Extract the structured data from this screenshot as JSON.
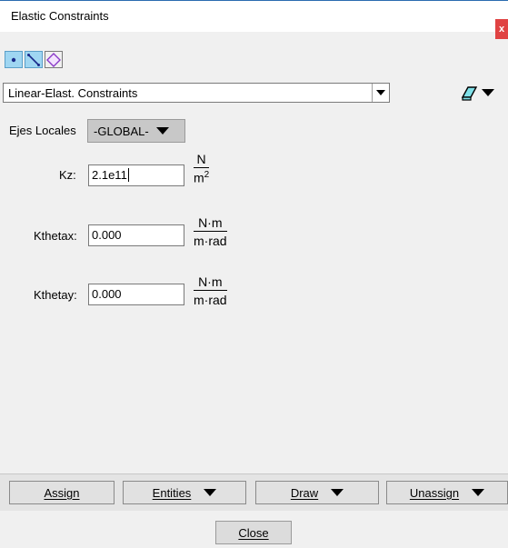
{
  "window": {
    "title": "Elastic Constraints",
    "close_glyph": "x"
  },
  "mode_buttons": [
    {
      "icon": "point-icon",
      "active": true
    },
    {
      "icon": "line-icon",
      "active": true
    },
    {
      "icon": "surface-icon",
      "active": false
    }
  ],
  "condition_select": {
    "value": "Linear-Elast. Constraints"
  },
  "ejes": {
    "label": "Ejes Locales",
    "value": "-GLOBAL-"
  },
  "fields": [
    {
      "label": "Kz:",
      "value": "2.1e11",
      "unit_num": "N",
      "unit_den": "m",
      "unit_den_sup": "2"
    },
    {
      "label": "Kthetax:",
      "value": "0.000",
      "unit_num": "N·m",
      "unit_den": "m·rad",
      "unit_den_sup": ""
    },
    {
      "label": "Kthetay:",
      "value": "0.000",
      "unit_num": "N·m",
      "unit_den": "m·rad",
      "unit_den_sup": ""
    }
  ],
  "bottom_buttons": {
    "assign": "Assign",
    "entities": "Entities",
    "draw": "Draw",
    "unassign": "Unassign"
  },
  "close_button": "Close",
  "colors": {
    "active_mode": "#9fd6f2",
    "close_red": "#e04343"
  }
}
